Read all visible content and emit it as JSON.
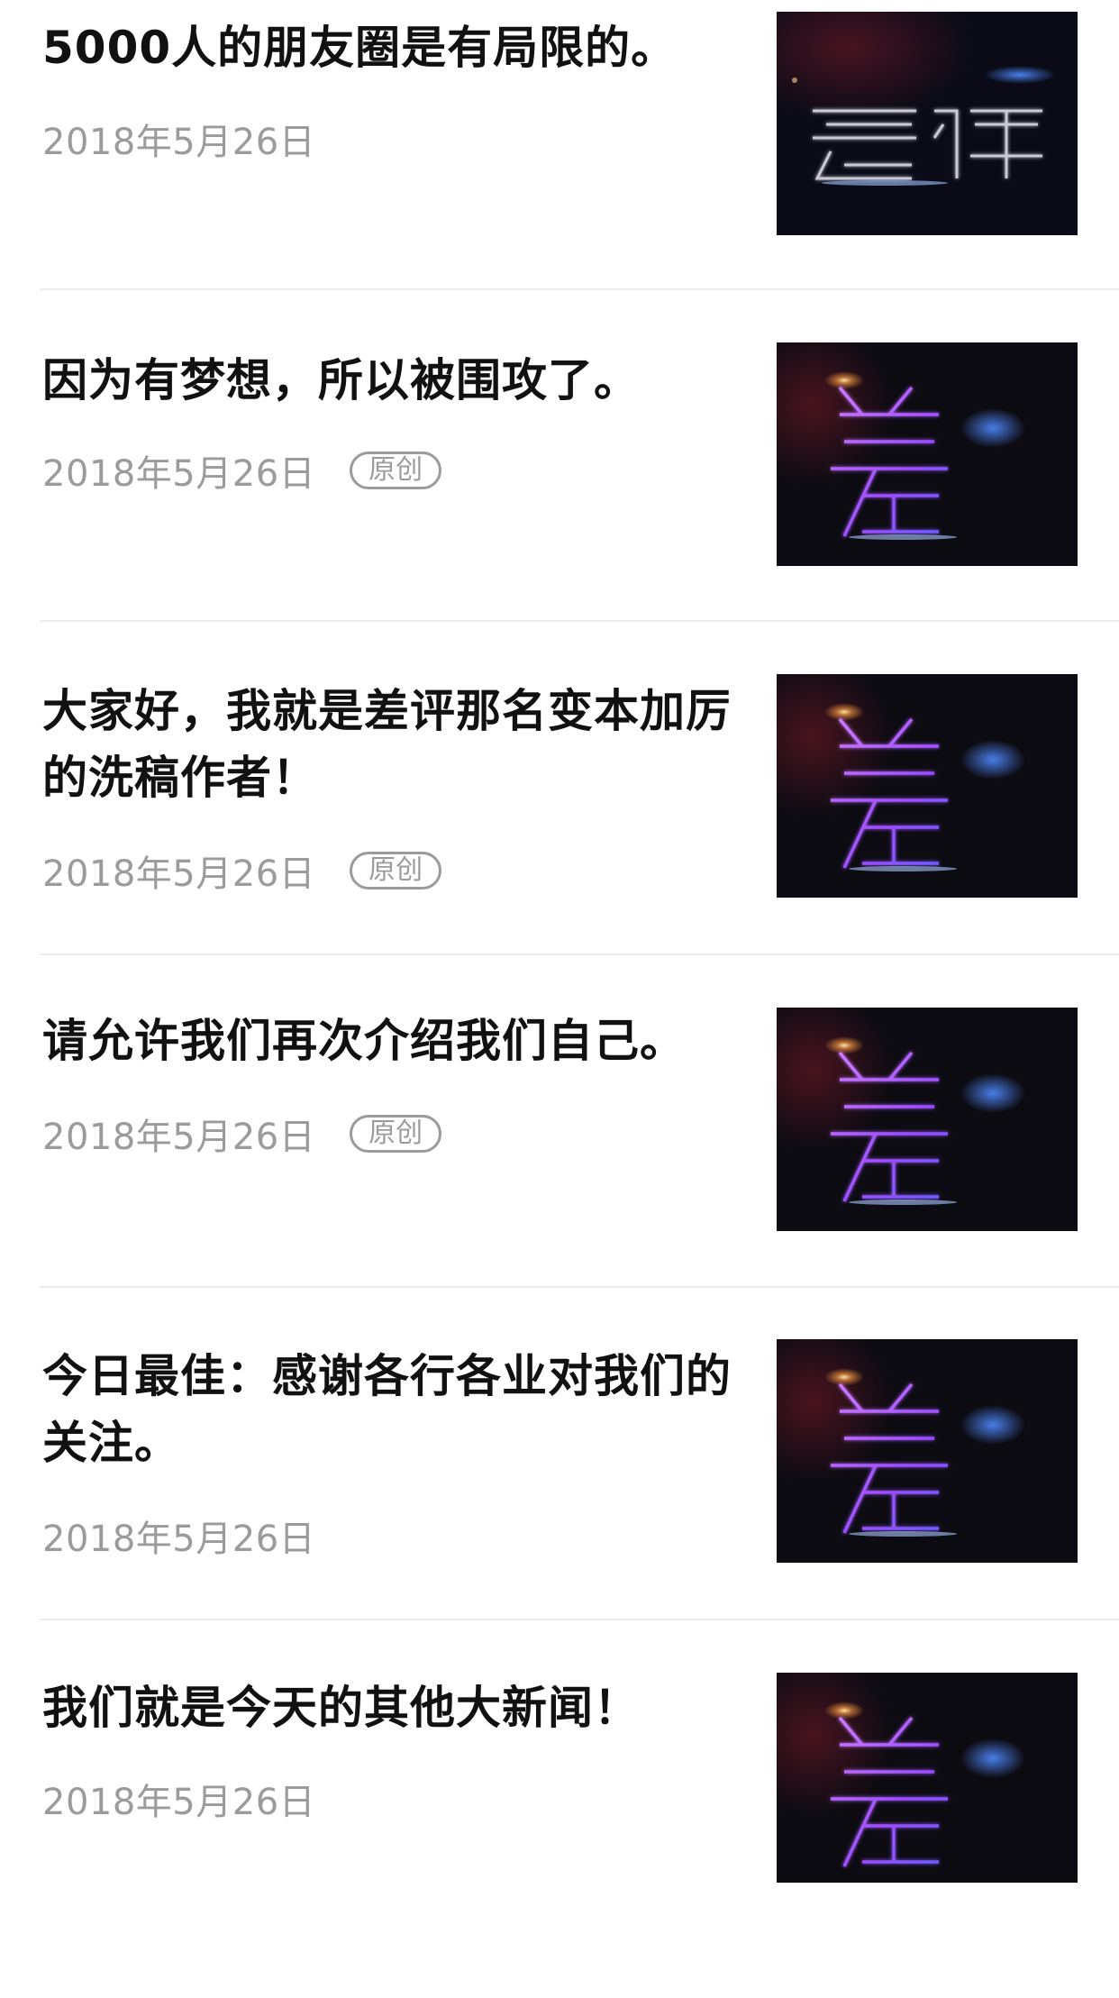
{
  "articles": [
    {
      "title": "5000人的朋友圈是有局限的。",
      "date": "2018年5月26日",
      "badge": "",
      "thumbnail_icon": "chaping-logo-text-thumbnail"
    },
    {
      "title": "因为有梦想，所以被围攻了。",
      "date": "2018年5月26日",
      "badge": "原创",
      "thumbnail_icon": "chaping-logo-thumbnail"
    },
    {
      "title": "大家好，我就是差评那名变本加厉的洗稿作者！",
      "date": "2018年5月26日",
      "badge": "原创",
      "thumbnail_icon": "chaping-logo-thumbnail"
    },
    {
      "title": "请允许我们再次介绍我们自己。",
      "date": "2018年5月26日",
      "badge": "原创",
      "thumbnail_icon": "chaping-logo-thumbnail"
    },
    {
      "title": "今日最佳：感谢各行各业对我们的关注。",
      "date": "2018年5月26日",
      "badge": "",
      "thumbnail_icon": "chaping-logo-thumbnail"
    },
    {
      "title": "我们就是今天的其他大新闻！",
      "date": "2018年5月26日",
      "badge": "",
      "thumbnail_icon": "chaping-logo-thumbnail"
    }
  ],
  "colors": {
    "title": "#111111",
    "meta": "#9b9b9b",
    "divider": "#ececec",
    "thumbnail_bg": "#0c0b10",
    "glow_purple": "#b85cff",
    "glow_blue": "#5a7dff"
  }
}
